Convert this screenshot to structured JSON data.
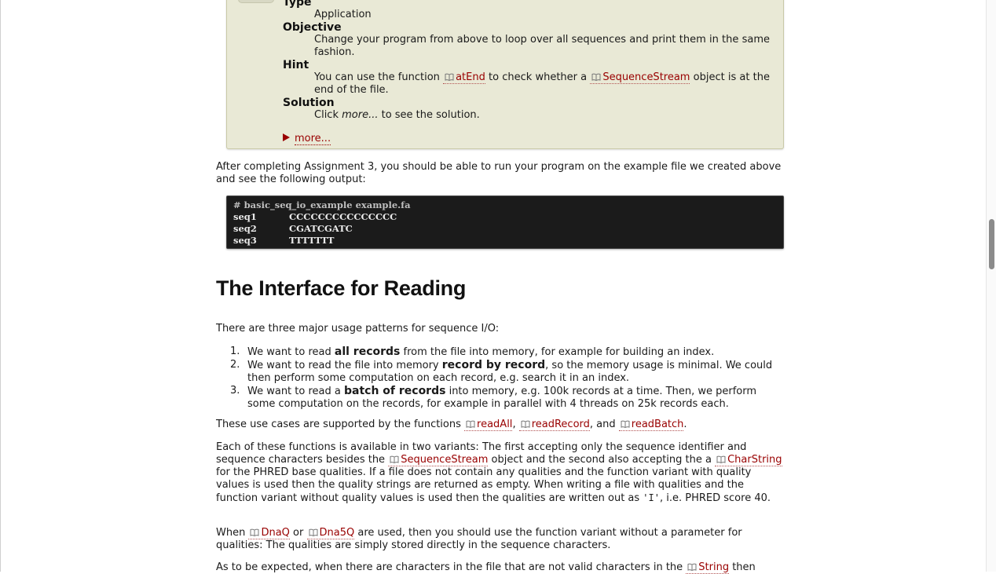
{
  "assignment": {
    "type_label": "Type",
    "type_value": "Application",
    "objective_label": "Objective",
    "objective_text": "Change your program from above to loop over all sequences and print them in the same fashion.",
    "hint_label": "Hint",
    "hint_prefix": "You can use the function ",
    "hint_ref1": "atEnd",
    "hint_middle": " to check whether a ",
    "hint_ref2": "SequenceStream",
    "hint_suffix": " object is at the end of the file.",
    "solution_label": "Solution",
    "solution_prefix": "Click ",
    "solution_italic": "more...",
    "solution_suffix": " to see the solution.",
    "more_link": "more..."
  },
  "para_after": "After completing Assignment 3, you should be able to run your program on the example file we created above and see the following output:",
  "code": {
    "line1": "# basic_seq_io_example example.fa",
    "rows": [
      {
        "id": "seq1",
        "seq": "CCCCCCCCCCCCCCC"
      },
      {
        "id": "seq2",
        "seq": "CGATCGATC"
      },
      {
        "id": "seq3",
        "seq": "TTTTTTT"
      }
    ]
  },
  "heading": "The Interface for Reading",
  "intro": "There are three major usage patterns for sequence I/O:",
  "list": [
    {
      "num": "1.",
      "pre": "We want to read ",
      "bold": "all records",
      "post": " from the file into memory, for example for building an index."
    },
    {
      "num": "2.",
      "pre": "We want to read the file into memory ",
      "bold": "record by record",
      "post": ", so the memory usage is minimal. We could then perform some computation on each record, e.g. search it in an index."
    },
    {
      "num": "3.",
      "pre": "We want to read a ",
      "bold": "batch of records",
      "post": " into memory, e.g. 100k records at a time. Then, we perform some computation on the records, for example in parallel with 4 threads on 25k records each."
    }
  ],
  "para_functions": {
    "pre": "These use cases are supported by the functions ",
    "ref1": "readAll",
    "sep1": ", ",
    "ref2": "readRecord",
    "sep2": ", and ",
    "ref3": "readBatch",
    "post": "."
  },
  "para_variants": {
    "t1": "Each of these functions is available in two variants: The first accepting only the sequence identifier and sequence characters besides the ",
    "ref1": "SequenceStream",
    "t2": " object and the second also accepting the a ",
    "ref2": "CharString",
    "t3": " for the PHRED base qualities. If a file does not contain any qualities and the function variant with quality values is used then the quality strings are returned as empty. When writing a file with qualities and the function variant without quality values is used then the qualities are written out as ",
    "code": "'I'",
    "t4": ", i.e. PHRED score 40."
  },
  "para_dnaq": {
    "t1": "When ",
    "ref1": "DnaQ",
    "t2": " or ",
    "ref2": "Dna5Q",
    "t3": " are used, then you should use the function variant without a parameter for qualities: The qualities are simply stored directly in the sequence characters."
  },
  "para_last": {
    "t1": "As to be expected, when there are characters in the file that are not valid characters in the ",
    "ref1": "String",
    "t2": " then"
  },
  "colors": {
    "link": "#990000",
    "box_bg": "#e9e9d6",
    "code_bg": "#1b1b1b"
  },
  "icons": {
    "ref_icon": "book-icon",
    "more_icon": "triangle-right-icon"
  }
}
